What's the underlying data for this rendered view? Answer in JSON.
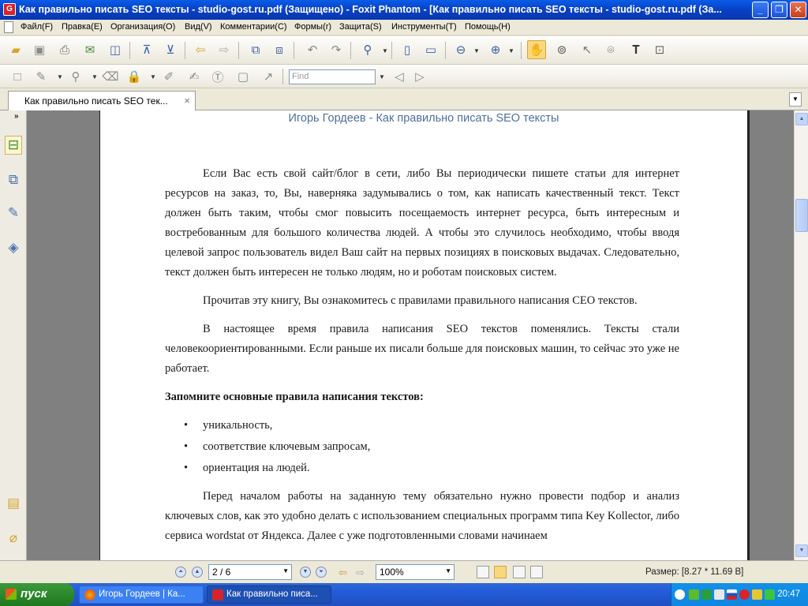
{
  "window": {
    "title": "Как правильно писать SEO тексты - studio-gost.ru.pdf (Защищено) - Foxit Phantom - [Как правильно писать SEO тексты - studio-gost.ru.pdf (За...",
    "app_icon": "foxit-logo-icon",
    "buttons": {
      "minimize": "_",
      "maximize": "❐",
      "close": "✕"
    }
  },
  "menu": [
    "Файл(F)",
    "Правка(E)",
    "Организация(O)",
    "Вид(V)",
    "Комментарии(C)",
    "Формы(r)",
    "Защита(S)",
    "Инструменты(T)",
    "Помощь(H)"
  ],
  "toolbar2": {
    "find_placeholder": "Find"
  },
  "tab": {
    "label": "Как правильно писать SEO тек...",
    "close": "×"
  },
  "document": {
    "header": "Игорь Гордеев - Как правильно писать SEO тексты",
    "paragraph1": "Если Вас есть свой сайт/блог в сети, либо Вы периодически пишете статьи для интернет ресурсов на заказ, то, Вы, наверняка задумывались о том, как написать качественный текст. Текст должен быть таким, чтобы смог повысить посещаемость интернет ресурса, быть интересным и востребованным для большого количества людей. А чтобы это случилось необходимо, чтобы вводя целевой запрос пользователь видел Ваш сайт на первых позициях в поисковых выдачах.  Следовательно, текст должен быть интересен не только людям, но и роботам поисковых систем.",
    "paragraph2": "Прочитав эту книгу, Вы ознакомитесь с правилами правильного написания СЕО текстов.",
    "paragraph3": "В настоящее время правила написания SEO текстов поменялись. Тексты стали человекоориентированными. Если раньше их писали больше для поисковых машин, то сейчас это уже не работает.",
    "heading": "Запомните основные правила написания текстов:",
    "bullets": [
      "уникальность,",
      "соответствие ключевым запросам,",
      "ориентация на людей."
    ],
    "paragraph4": "Перед началом работы на заданную тему обязательно нужно провести подбор  и анализ ключевых слов, как это удобно делать с использованием специальных программ типа Key Kollector, либо сервиса wordstat от Яндекса. Далее с уже подготовленными словами начинаем"
  },
  "statusbar": {
    "page": "2 / 6",
    "zoom": "100%",
    "size": "Размер: [8.27 * 11.69 B]"
  },
  "taskbar": {
    "start": "пуск",
    "items": [
      "Игорь Гордеев | Ка...",
      "Как правильно писа..."
    ],
    "clock": "20:47"
  },
  "colors": {
    "titlebar": "#0842c9",
    "taskbar": "#245edb",
    "start_button": "#2f8b2f",
    "doc_header": "#4d6f9b",
    "active_tool": "#f9d77e"
  }
}
